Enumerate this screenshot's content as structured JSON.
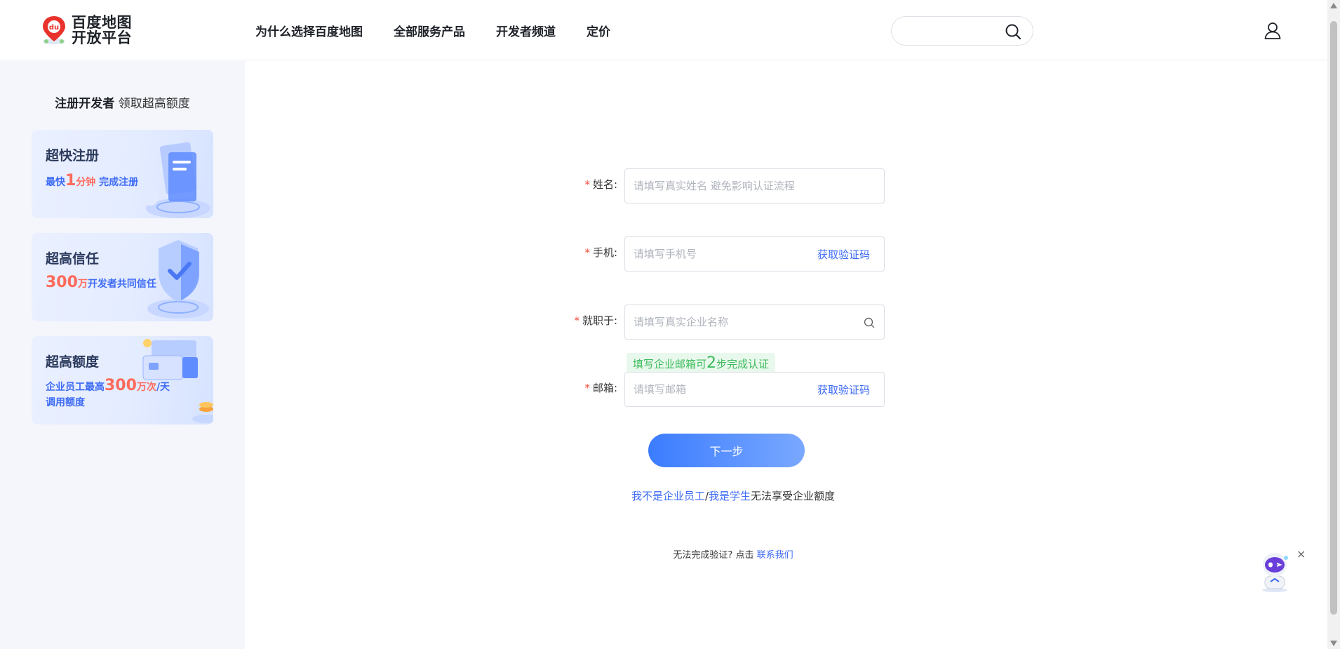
{
  "header": {
    "logo_line1": "百度地图",
    "logo_line2": "开放平台",
    "logo_badge": "du",
    "nav": [
      {
        "label": "为什么选择百度地图"
      },
      {
        "label": "全部服务产品"
      },
      {
        "label": "开发者频道"
      },
      {
        "label": "定价"
      }
    ],
    "search_value": "",
    "search_icon": "search-icon",
    "user_icon": "user-icon"
  },
  "sidebar": {
    "title_bold": "注册开发者",
    "title_rest": " 领取超高额度",
    "cards": [
      {
        "title": "超快注册",
        "sub_prefix": "最快",
        "sub_num": "1",
        "sub_unit": "分钟",
        "sub_suffix": " 完成注册"
      },
      {
        "title": "超高信任",
        "sub_num": "300",
        "sub_unit": "万",
        "sub_suffix": "开发者共同信任"
      },
      {
        "title": "超高额度",
        "sub_prefix": "企业员工最高",
        "sub_num": "300",
        "sub_unit": "万次",
        "sub_suffix": "/天",
        "sub_line2": "调用额度"
      }
    ]
  },
  "form": {
    "name": {
      "label": "姓名:",
      "placeholder": "请填写真实姓名 避免影响认证流程",
      "value": ""
    },
    "phone": {
      "label": "手机:",
      "placeholder": "请填写手机号",
      "value": "",
      "code_label": "获取验证码"
    },
    "company": {
      "label": "就职于:",
      "placeholder": "请填写真实企业名称",
      "value": ""
    },
    "hint_prefix": "填写企业邮箱可",
    "hint_num": "2",
    "hint_suffix": "步完成认证",
    "email": {
      "label": "邮箱:",
      "placeholder": "请填写邮箱",
      "value": "",
      "code_label": "获取验证码"
    },
    "required_mark": "*",
    "next_label": "下一步",
    "alt_link1": "我不是企业员工",
    "alt_sep": "/",
    "alt_link2": "我是学生",
    "alt_tail": "无法享受企业额度",
    "help_text": "无法完成验证? 点击 ",
    "help_link": "联系我们"
  },
  "colors": {
    "accent": "#3e6bf5",
    "required": "#f04b3b",
    "hint_green": "#3cbb5c",
    "sidebar_bg": "#f4f6fb"
  },
  "assistant": {
    "close_label": "×",
    "icon": "robot-assistant-icon"
  }
}
